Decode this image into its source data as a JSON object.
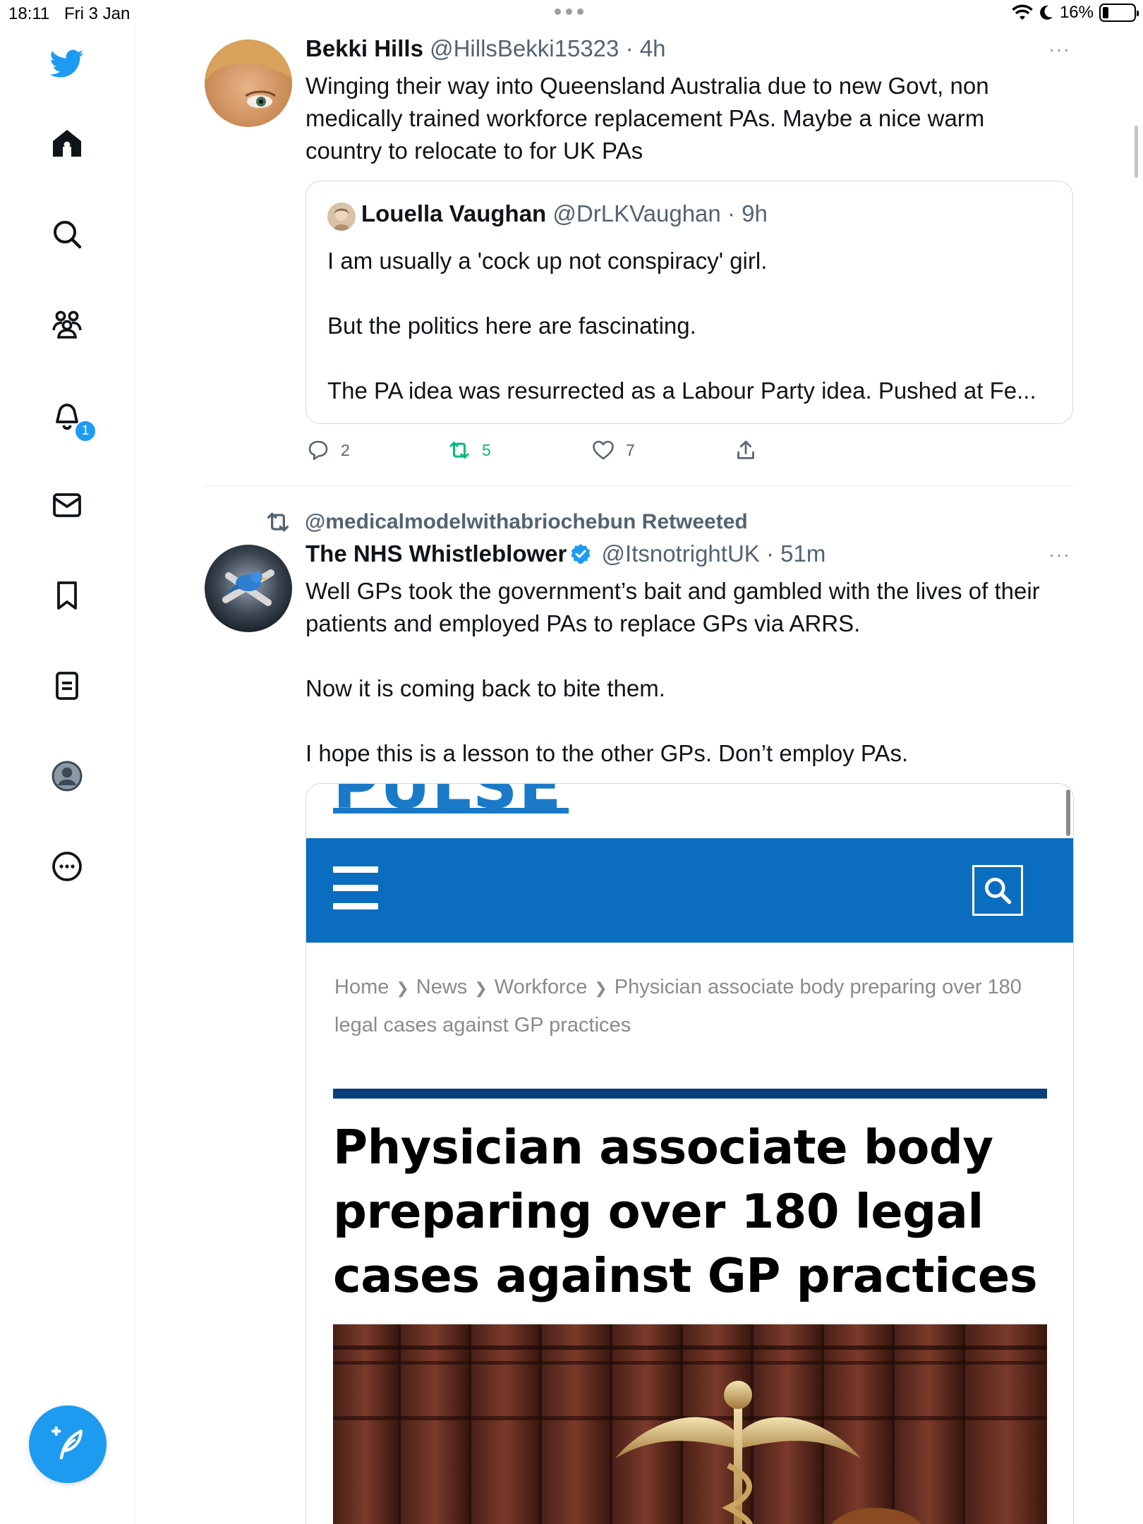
{
  "status_bar": {
    "time": "18:11",
    "date": "Fri 3 Jan",
    "battery": "16%"
  },
  "sidebar": {
    "items": [
      "twitter-logo",
      "home",
      "explore",
      "communities",
      "notifications",
      "messages",
      "bookmarks",
      "lists",
      "profile",
      "more"
    ],
    "notification_count": "1"
  },
  "tweets": [
    {
      "name": "Bekki Hills",
      "handle": "@HillsBekki15323",
      "time": "· 4h",
      "more": "···",
      "text": "Winging their way into Queensland Australia due to new Govt, non medically trained workforce replacement PAs. Maybe a nice warm country to relocate to for UK PAs",
      "quote": {
        "name": "Louella Vaughan",
        "handle": "@DrLKVaughan",
        "time": "· 9h",
        "lines": [
          "I am usually a 'cock up not conspiracy' girl.",
          "But the politics here are fascinating.",
          "The PA idea was resurrected as a Labour Party idea. Pushed at Fe..."
        ]
      },
      "replies": "2",
      "retweets": "5",
      "likes": "7"
    },
    {
      "retweeted_by": "@medicalmodelwithabriochebun Retweeted",
      "name": "The NHS Whistleblower",
      "handle": "@ItsnotrightUK",
      "time": "· 51m",
      "more": "···",
      "paragraphs": [
        "Well GPs took the  government’s bait and gambled with the lives of their patients and employed PAs to replace GPs via ARRS.",
        "Now it is coming back to bite them.",
        "I hope this is a lesson to the other GPs.  Don’t employ PAs."
      ],
      "card": {
        "logo": "PULSE",
        "breadcrumbs": [
          "Home",
          "News",
          "Workforce",
          "Physician associate body preparing over 180 legal cases against GP practices"
        ],
        "headline": "Physician associate body preparing over 180 legal cases against GP practices"
      }
    }
  ],
  "colors": {
    "accent": "#1d9bf0",
    "retweet_green": "#00ba7c",
    "pulse_blue": "#0a6dbf",
    "rule_navy": "#0a3f7d"
  }
}
